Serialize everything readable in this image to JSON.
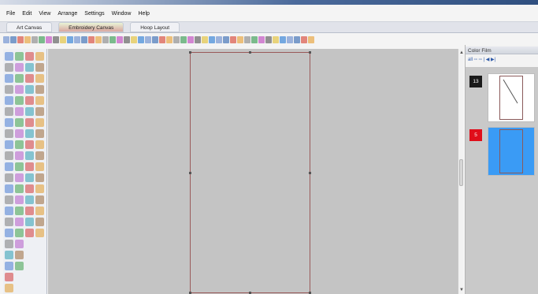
{
  "menu": [
    "File",
    "Edit",
    "View",
    "Arrange",
    "Settings",
    "Window",
    "Help"
  ],
  "tabs": [
    {
      "label": "Art Canvas"
    },
    {
      "label": "Embroidery Canvas"
    },
    {
      "label": "Hoop Layout"
    }
  ],
  "color_film": {
    "title": "Color Film",
    "tools": "all ▫▫ ▫▫ | ◀ ▶|",
    "entries": [
      {
        "number": "13",
        "badge_color": "#1a1a1a",
        "thumb_color": "#ffffff"
      },
      {
        "number": "5",
        "badge_color": "#e00e1a",
        "thumb_color": "#3a9bf5"
      }
    ]
  },
  "colors": {
    "canvas": "#c4c4c4",
    "hoop_border": "#9a5a5a",
    "active_tab": "#d9a6a0"
  }
}
